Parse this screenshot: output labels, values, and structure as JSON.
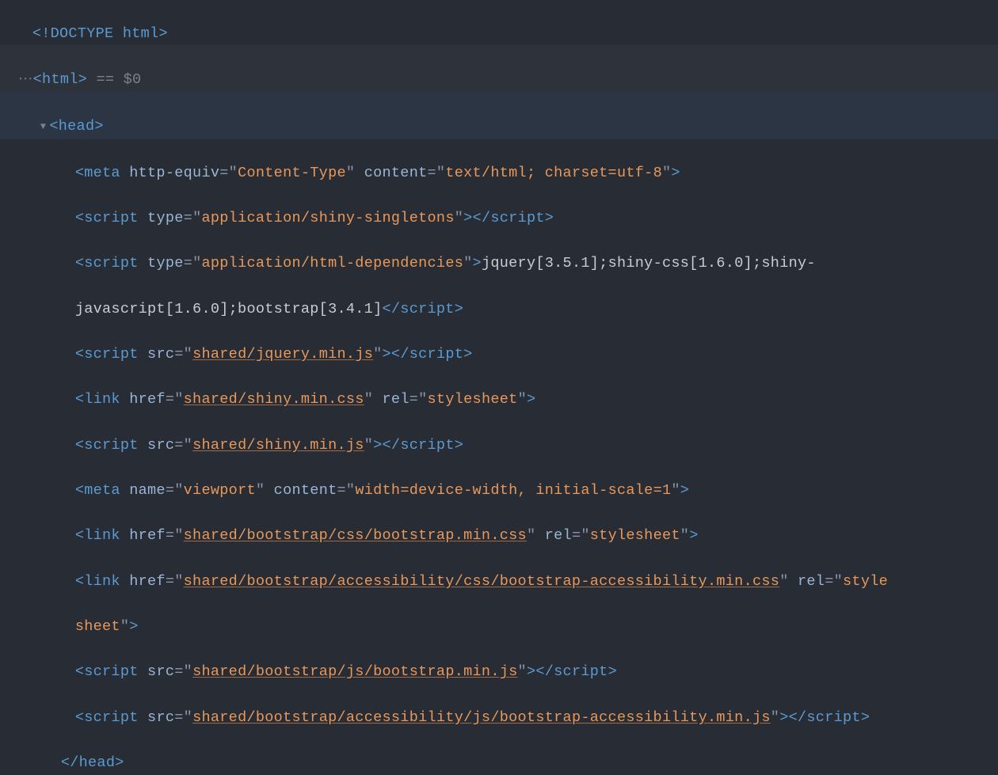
{
  "glyphs": {
    "dots": "⋯",
    "arrow": "▼"
  },
  "l0": {
    "open": "<!",
    "tag": "DOCTYPE html",
    "close": ">"
  },
  "l1": {
    "open": "<",
    "tag": "html",
    "close": ">",
    "eqdollar": " == $0"
  },
  "l2": {
    "open": "<",
    "tag": "head",
    "close": ">"
  },
  "l3": {
    "open": "<",
    "tag": "meta",
    "a1": " http-equiv",
    "eq": "=",
    "q": "\"",
    "v1": "Content-Type",
    "a2": " content",
    "v2": "text/html; charset=utf-8",
    "close": ">"
  },
  "l4": {
    "open": "<",
    "tag": "script",
    "a1": " type",
    "eq": "=",
    "q": "\"",
    "v1": "application/shiny-singletons",
    "close": ">",
    "open2": "</",
    "close2": ">"
  },
  "l5": {
    "open": "<",
    "tag": "script",
    "a1": " type",
    "eq": "=",
    "q": "\"",
    "v1": "application/html-dependencies",
    "close": ">",
    "text_a": "jquery[3.5.1];shiny-css[1.6.0];shiny-",
    "text_b": "javascript[1.6.0];bootstrap[3.4.1]",
    "open2": "</",
    "close2": ">"
  },
  "l6": {
    "open": "<",
    "tag": "script",
    "a1": " src",
    "eq": "=",
    "q": "\"",
    "v1": "shared/jquery.min.js",
    "close": ">",
    "open2": "</",
    "close2": ">"
  },
  "l7": {
    "open": "<",
    "tag": "link",
    "a1": " href",
    "eq": "=",
    "q": "\"",
    "v1": "shared/shiny.min.css",
    "a2": " rel",
    "v2": "stylesheet",
    "close": ">"
  },
  "l8": {
    "open": "<",
    "tag": "script",
    "a1": " src",
    "eq": "=",
    "q": "\"",
    "v1": "shared/shiny.min.js",
    "close": ">",
    "open2": "</",
    "close2": ">"
  },
  "l9": {
    "open": "<",
    "tag": "meta",
    "a1": " name",
    "eq": "=",
    "q": "\"",
    "v1": "viewport",
    "a2": " content",
    "v2": "width=device-width, initial-scale=1",
    "close": ">"
  },
  "l10": {
    "open": "<",
    "tag": "link",
    "a1": " href",
    "eq": "=",
    "q": "\"",
    "v1": "shared/bootstrap/css/bootstrap.min.css",
    "a2": " rel",
    "v2": "stylesheet",
    "close": ">"
  },
  "l11": {
    "open": "<",
    "tag": "link",
    "a1": " href",
    "eq": "=",
    "q": "\"",
    "v1": "shared/bootstrap/accessibility/css/bootstrap-accessibility.min.css",
    "a2": " rel",
    "v2a": "style",
    "v2b": "sheet",
    "close": ">"
  },
  "l12": {
    "open": "<",
    "tag": "script",
    "a1": " src",
    "eq": "=",
    "q": "\"",
    "v1": "shared/bootstrap/js/bootstrap.min.js",
    "close": ">",
    "open2": "</",
    "close2": ">"
  },
  "l13": {
    "open": "<",
    "tag": "script",
    "a1": " src",
    "eq": "=",
    "q": "\"",
    "v1": "shared/bootstrap/accessibility/js/bootstrap-accessibility.min.js",
    "close": ">",
    "open2": "</",
    "close2": ">"
  },
  "l14": {
    "open": "</",
    "tag": "head",
    "close": ">"
  }
}
